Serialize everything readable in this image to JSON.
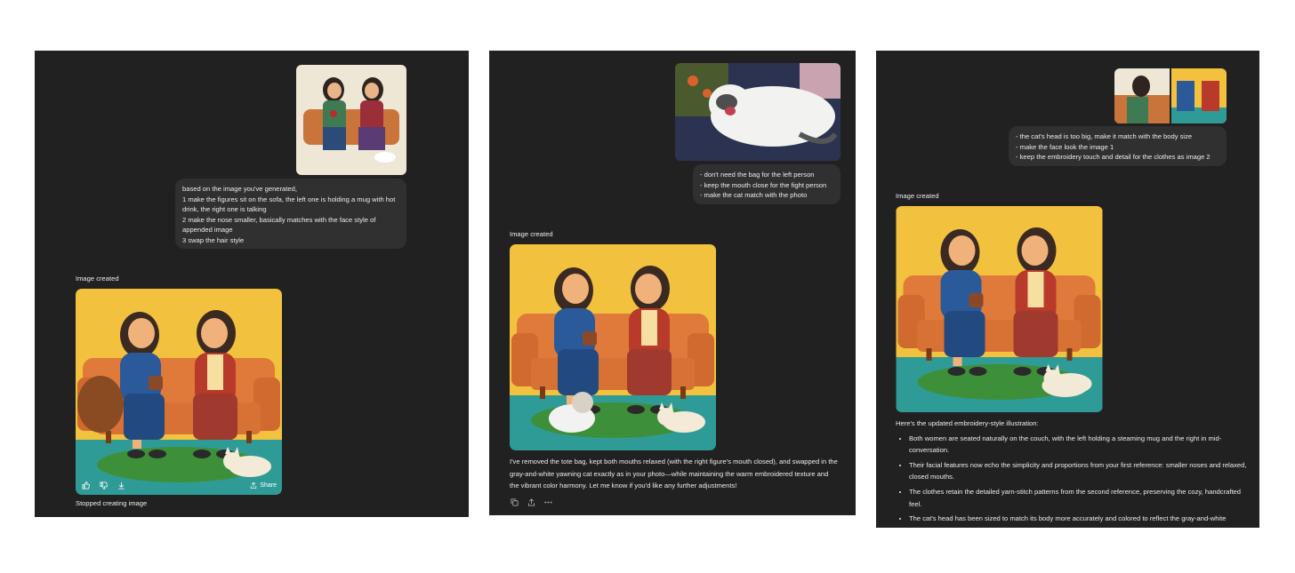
{
  "panel1": {
    "user_message": [
      "based on the image you've generated,",
      "1 make the figures sit on the sofa, the left one is holding a mug with hot drink, the right one is talking",
      "2 make the nose smaller, basically matches with the face style of appended image",
      "3 swap the hair style"
    ],
    "image_status": "Image created",
    "share_label": "Share",
    "footer_status": "Stopped creating image"
  },
  "panel2": {
    "user_message": [
      "- don't need the bag for the left person",
      "- keep the mouth close for the fight person",
      "- make the cat match with the photo"
    ],
    "image_status": "Image created",
    "reply": "I've removed the tote bag, kept both mouths relaxed (with the right figure's mouth closed), and swapped in the gray-and-white yawning cat exactly as in your photo—while maintaining the warm embroidered texture and the vibrant color harmony. Let me know if you'd like any further adjustments!"
  },
  "panel3": {
    "user_message": [
      "- the cat's head is too big, make it match with the body size",
      "- make the face look the image 1",
      "- keep the embroidery touch and detail for the clothes as image 2"
    ],
    "image_status": "Image created",
    "reply_intro": "Here's the updated embroidery-style illustration:",
    "bullets": [
      "Both women are seated naturally on the couch, with the left holding a steaming mug and the right in mid-conversation.",
      "Their facial features now echo the simplicity and proportions from your first reference: smaller noses and relaxed, closed mouths.",
      "The clothes retain the detailed yarn-stitch patterns from the second reference, preserving the cozy, handcrafted feel.",
      "The cat's head has been sized to match its body more accurately and colored to reflect the gray-and-white pattern in your photo."
    ]
  },
  "colors": {
    "panel_bg": "#212121",
    "bubble_bg": "#303030",
    "text": "#ececec",
    "yellow_bg": "#f2c23f",
    "sofa": "#e07a3a",
    "teal_floor": "#2f9b97",
    "rug": "#3e8f3a"
  },
  "icons": [
    "thumbs-up-icon",
    "thumbs-down-icon",
    "download-icon",
    "share-icon",
    "copy-icon",
    "upload-icon",
    "more-icon"
  ]
}
